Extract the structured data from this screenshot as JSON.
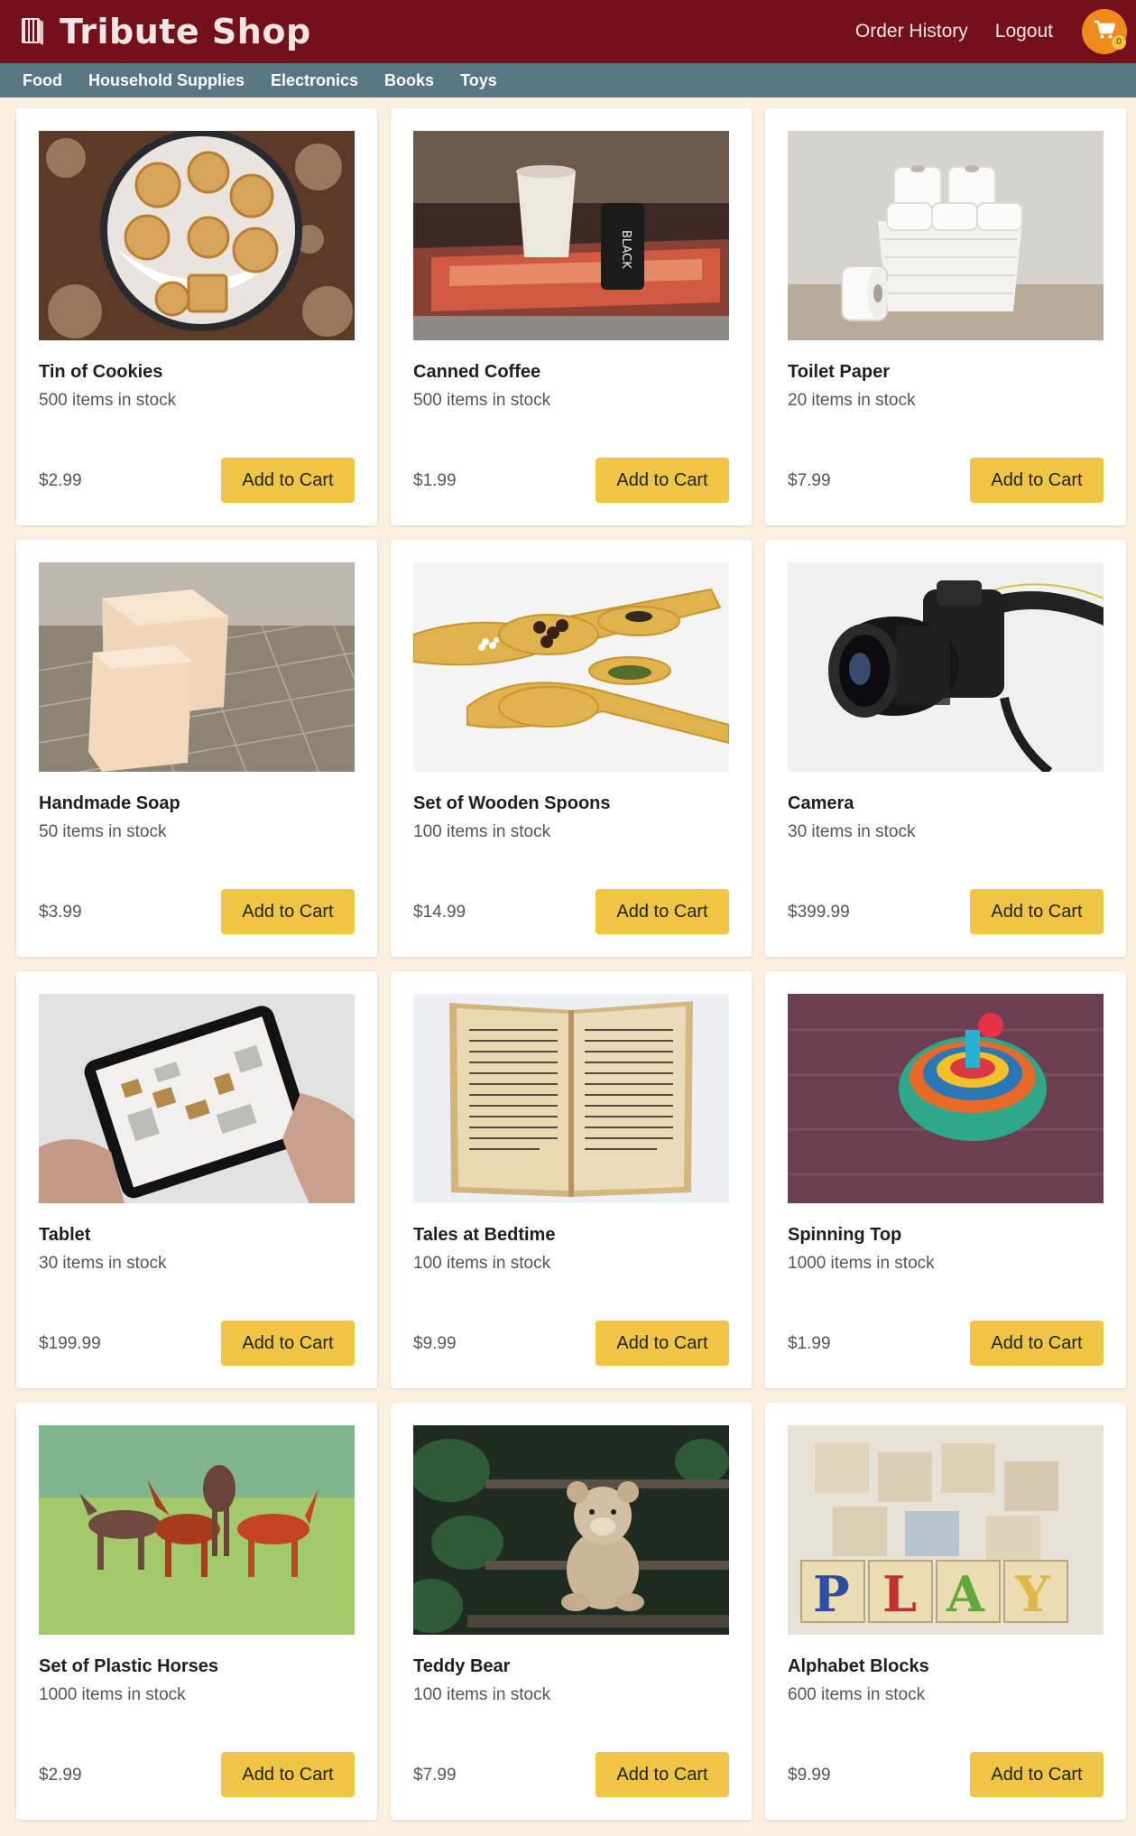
{
  "header": {
    "title": "Tribute Shop",
    "links": [
      "Order History",
      "Logout"
    ],
    "cart_count": "0"
  },
  "categories": [
    "Food",
    "Household Supplies",
    "Electronics",
    "Books",
    "Toys"
  ],
  "button_label": "Add to Cart",
  "products": [
    {
      "name": "Tin of Cookies",
      "stock": "500 items in stock",
      "price": "$2.99",
      "image": "cookies"
    },
    {
      "name": "Canned Coffee",
      "stock": "500 items in stock",
      "price": "$1.99",
      "image": "coffee"
    },
    {
      "name": "Toilet Paper",
      "stock": "20 items in stock",
      "price": "$7.99",
      "image": "toilet-paper"
    },
    {
      "name": "Handmade Soap",
      "stock": "50 items in stock",
      "price": "$3.99",
      "image": "soap"
    },
    {
      "name": "Set of Wooden Spoons",
      "stock": "100 items in stock",
      "price": "$14.99",
      "image": "spoons"
    },
    {
      "name": "Camera",
      "stock": "30 items in stock",
      "price": "$399.99",
      "image": "camera"
    },
    {
      "name": "Tablet",
      "stock": "30 items in stock",
      "price": "$199.99",
      "image": "tablet"
    },
    {
      "name": "Tales at Bedtime",
      "stock": "100 items in stock",
      "price": "$9.99",
      "image": "book"
    },
    {
      "name": "Spinning Top",
      "stock": "1000 items in stock",
      "price": "$1.99",
      "image": "spinning-top"
    },
    {
      "name": "Set of Plastic Horses",
      "stock": "1000 items in stock",
      "price": "$2.99",
      "image": "horses"
    },
    {
      "name": "Teddy Bear",
      "stock": "100 items in stock",
      "price": "$7.99",
      "image": "teddy-bear"
    },
    {
      "name": "Alphabet Blocks",
      "stock": "600 items in stock",
      "price": "$9.99",
      "image": "blocks"
    }
  ],
  "colors": {
    "header_bg": "#74101a",
    "category_bg": "#587684",
    "page_bg": "#fcefe2",
    "button_bg": "#f0c544",
    "cart_bg": "#f08a1c"
  }
}
